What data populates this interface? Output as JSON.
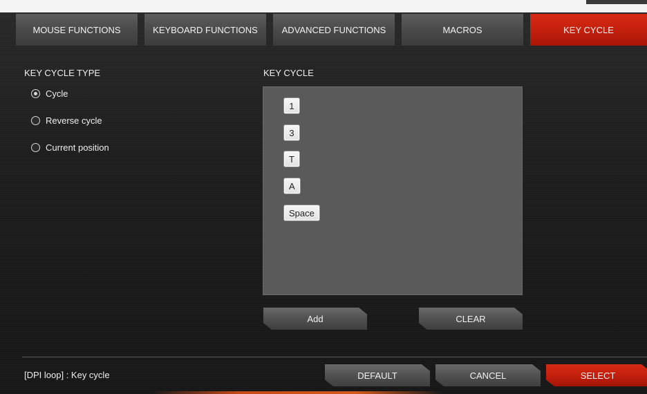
{
  "tabs": [
    {
      "label": "MOUSE FUNCTIONS",
      "active": false
    },
    {
      "label": "KEYBOARD FUNCTIONS",
      "active": false
    },
    {
      "label": "ADVANCED FUNCTIONS",
      "active": false
    },
    {
      "label": "MACROS",
      "active": false
    },
    {
      "label": "KEY CYCLE",
      "active": true
    }
  ],
  "key_cycle_type": {
    "title": "KEY CYCLE TYPE",
    "options": [
      {
        "label": "Cycle",
        "checked": true
      },
      {
        "label": "Reverse cycle",
        "checked": false
      },
      {
        "label": "Current position",
        "checked": false
      }
    ]
  },
  "key_cycle": {
    "title": "KEY CYCLE",
    "keys": [
      "1",
      "3",
      "T",
      "A",
      "Space"
    ],
    "add_label": "Add",
    "clear_label": "CLEAR"
  },
  "footer": {
    "status": "[DPI loop] : Key cycle",
    "default_label": "DEFAULT",
    "cancel_label": "CANCEL",
    "select_label": "SELECT"
  },
  "colors": {
    "accent_red": "#c01f0c",
    "tab_gray": "#4a4a4a",
    "panel_gray": "#5a5a5a"
  }
}
